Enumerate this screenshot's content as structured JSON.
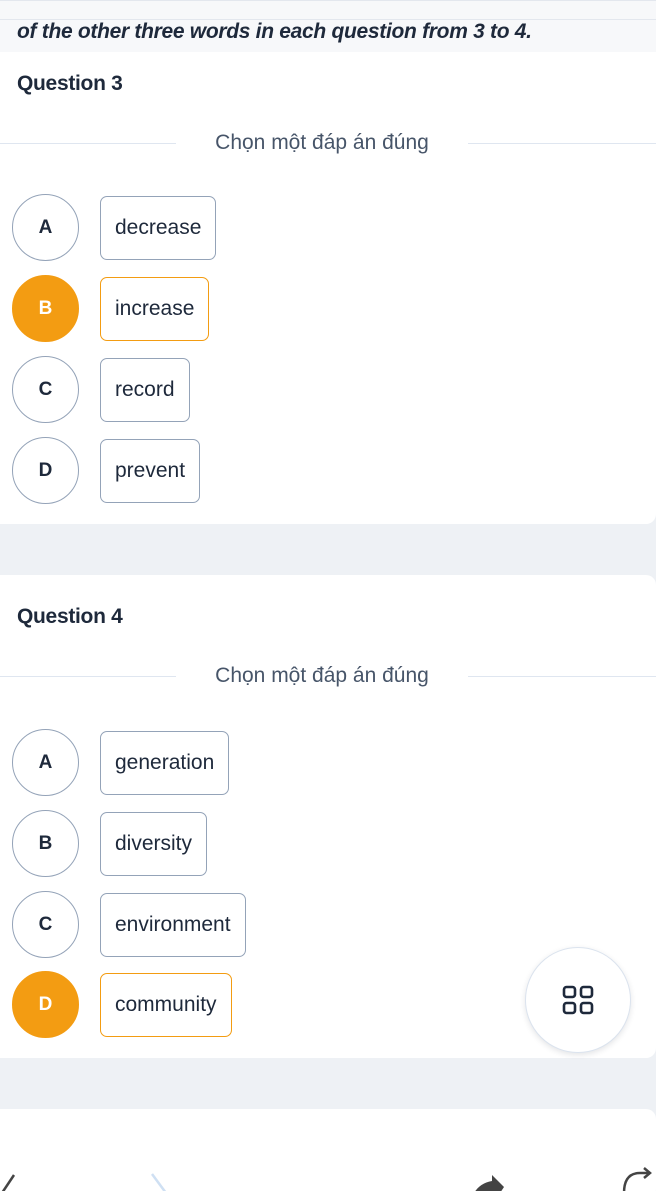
{
  "instruction_text": "of the other three words in each question from 3 to 4.",
  "questions": [
    {
      "title": "Question 3",
      "prompt": "Chọn một đáp án đúng",
      "options": [
        {
          "letter": "A",
          "text": "decrease",
          "selected": false
        },
        {
          "letter": "B",
          "text": "increase",
          "selected": true
        },
        {
          "letter": "C",
          "text": "record",
          "selected": false
        },
        {
          "letter": "D",
          "text": "prevent",
          "selected": false
        }
      ]
    },
    {
      "title": "Question 4",
      "prompt": "Chọn một đáp án đúng",
      "options": [
        {
          "letter": "A",
          "text": "generation",
          "selected": false
        },
        {
          "letter": "B",
          "text": "diversity",
          "selected": false
        },
        {
          "letter": "C",
          "text": "environment",
          "selected": false
        },
        {
          "letter": "D",
          "text": "community",
          "selected": true
        }
      ]
    }
  ],
  "fab": {
    "icon": "grid-icon"
  },
  "colors": {
    "selected": "#f39c12",
    "border": "#94a3b8",
    "text": "#1e293b"
  }
}
